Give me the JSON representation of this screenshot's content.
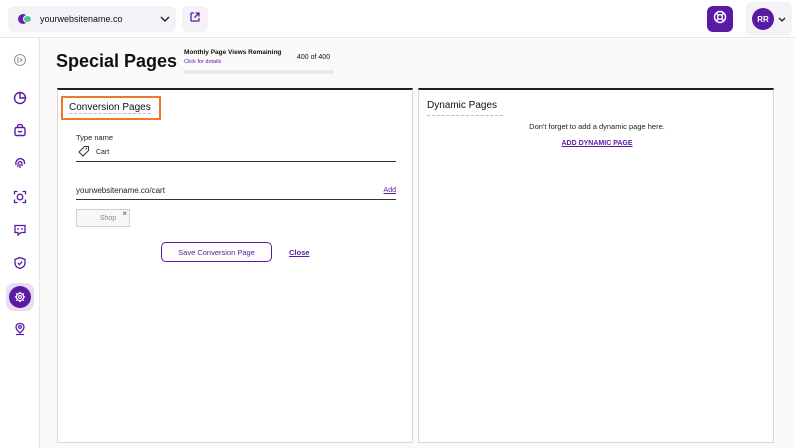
{
  "topbar": {
    "site_name": "yourwebsitename.co",
    "user_initials": "RR",
    "icons": {
      "site_logo": "site-logo-icon",
      "site_dropdown": "chevron-down-icon",
      "external_link": "external-link-icon",
      "help": "lifebuoy-icon",
      "user_dropdown": "chevron-down-icon"
    }
  },
  "sidebar": {
    "items": [
      {
        "name": "collapse",
        "icon": "collapse-icon",
        "active": false
      },
      {
        "name": "dashboard",
        "icon": "pie-chart-icon",
        "active": false
      },
      {
        "name": "shop",
        "icon": "shopping-bag-icon",
        "active": false
      },
      {
        "name": "fingerprint",
        "icon": "fingerprint-icon",
        "active": false
      },
      {
        "name": "focus",
        "icon": "focus-icon",
        "active": false
      },
      {
        "name": "messages",
        "icon": "message-icon",
        "active": false
      },
      {
        "name": "security",
        "icon": "shield-check-icon",
        "active": false
      },
      {
        "name": "settings",
        "icon": "gear-icon",
        "active": true
      },
      {
        "name": "location",
        "icon": "map-pin-icon",
        "active": false
      }
    ]
  },
  "header": {
    "title": "Special Pages",
    "page_views_label": "Monthly Page Views Remaining",
    "page_views_link": "Click for details",
    "page_views_count": "400 of 400",
    "page_views_used_fraction": 0
  },
  "conversion": {
    "title": "Conversion Pages",
    "type_label": "Type name",
    "type_value": "Cart",
    "type_icon": "tag-icon",
    "url_value": "yourwebsitename.co/cart",
    "add_label": "Add",
    "chip_label": "Shop",
    "chip_remove": "×",
    "save_label": "Save Conversion Page",
    "close_label": "Close"
  },
  "dynamic": {
    "title": "Dynamic Pages",
    "note": "Don't forget to add a dynamic page here.",
    "add_label": "ADD DYNAMIC PAGE"
  },
  "colors": {
    "accent": "#5b1aa3",
    "highlight": "#f0762b"
  }
}
